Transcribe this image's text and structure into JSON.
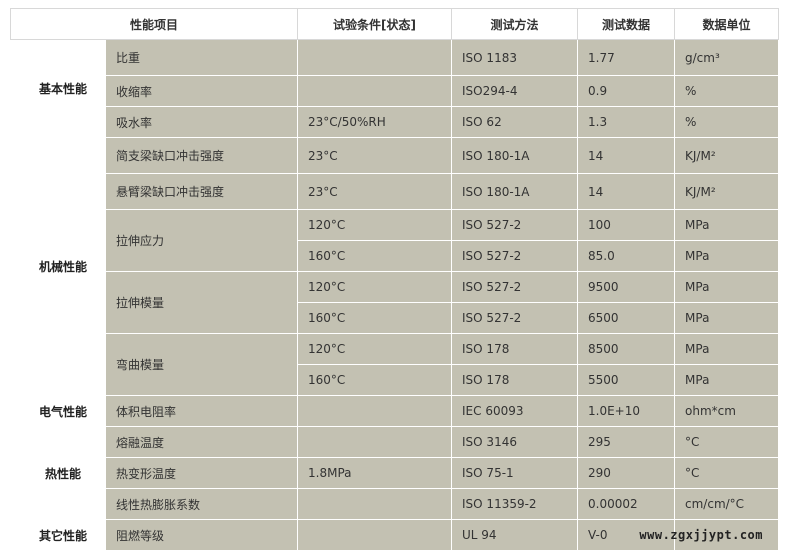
{
  "headers": [
    "性能项目",
    "试验条件[状态]",
    "测试方法",
    "测试数据",
    "数据单位"
  ],
  "categories": {
    "basic": "基本性能",
    "mechanical": "机械性能",
    "electrical": "电气性能",
    "thermal": "热性能",
    "other": "其它性能"
  },
  "rows": [
    {
      "prop": "比重",
      "cond": "",
      "method": "ISO 1183",
      "value": "1.77",
      "unit": "g/cm³"
    },
    {
      "prop": "收缩率",
      "cond": "",
      "method": "ISO294-4",
      "value": "0.9",
      "unit": "%"
    },
    {
      "prop": "吸水率",
      "cond": "23°C/50%RH",
      "method": "ISO 62",
      "value": "1.3",
      "unit": "%"
    },
    {
      "prop": "简支梁缺口冲击强度",
      "cond": "23°C",
      "method": "ISO 180-1A",
      "value": "14",
      "unit": "KJ/M²"
    },
    {
      "prop": "悬臂梁缺口冲击强度",
      "cond": "23°C",
      "method": "ISO 180-1A",
      "value": "14",
      "unit": "KJ/M²"
    },
    {
      "prop": "拉伸应力",
      "cond": "120°C",
      "method": "ISO 527-2",
      "value": "100",
      "unit": "MPa"
    },
    {
      "prop": "",
      "cond": "160°C",
      "method": "ISO 527-2",
      "value": "85.0",
      "unit": "MPa"
    },
    {
      "prop": "拉伸模量",
      "cond": "120°C",
      "method": "ISO 527-2",
      "value": "9500",
      "unit": "MPa"
    },
    {
      "prop": "",
      "cond": "160°C",
      "method": "ISO 527-2",
      "value": "6500",
      "unit": "MPa"
    },
    {
      "prop": "弯曲模量",
      "cond": "120°C",
      "method": "ISO 178",
      "value": "8500",
      "unit": "MPa"
    },
    {
      "prop": "",
      "cond": "160°C",
      "method": "ISO 178",
      "value": "5500",
      "unit": "MPa"
    },
    {
      "prop": "体积电阻率",
      "cond": "",
      "method": "IEC 60093",
      "value": "1.0E+10",
      "unit": "ohm*cm"
    },
    {
      "prop": "熔融温度",
      "cond": "",
      "method": "ISO 3146",
      "value": "295",
      "unit": "°C"
    },
    {
      "prop": "热变形温度",
      "cond": "1.8MPa",
      "method": "ISO 75-1",
      "value": "290",
      "unit": "°C"
    },
    {
      "prop": "线性热膨胀系数",
      "cond": "",
      "method": "ISO 11359-2",
      "value": "0.00002",
      "unit": "cm/cm/°C"
    },
    {
      "prop": "阻燃等级",
      "cond": "",
      "method": "UL 94",
      "value": "V-0",
      "unit": ""
    }
  ],
  "watermark": "www.zgxjjypt.com",
  "colors": {
    "cell_bg": "#c3c1b2",
    "header_bg": "#ffffff",
    "border": "#ffffff"
  }
}
